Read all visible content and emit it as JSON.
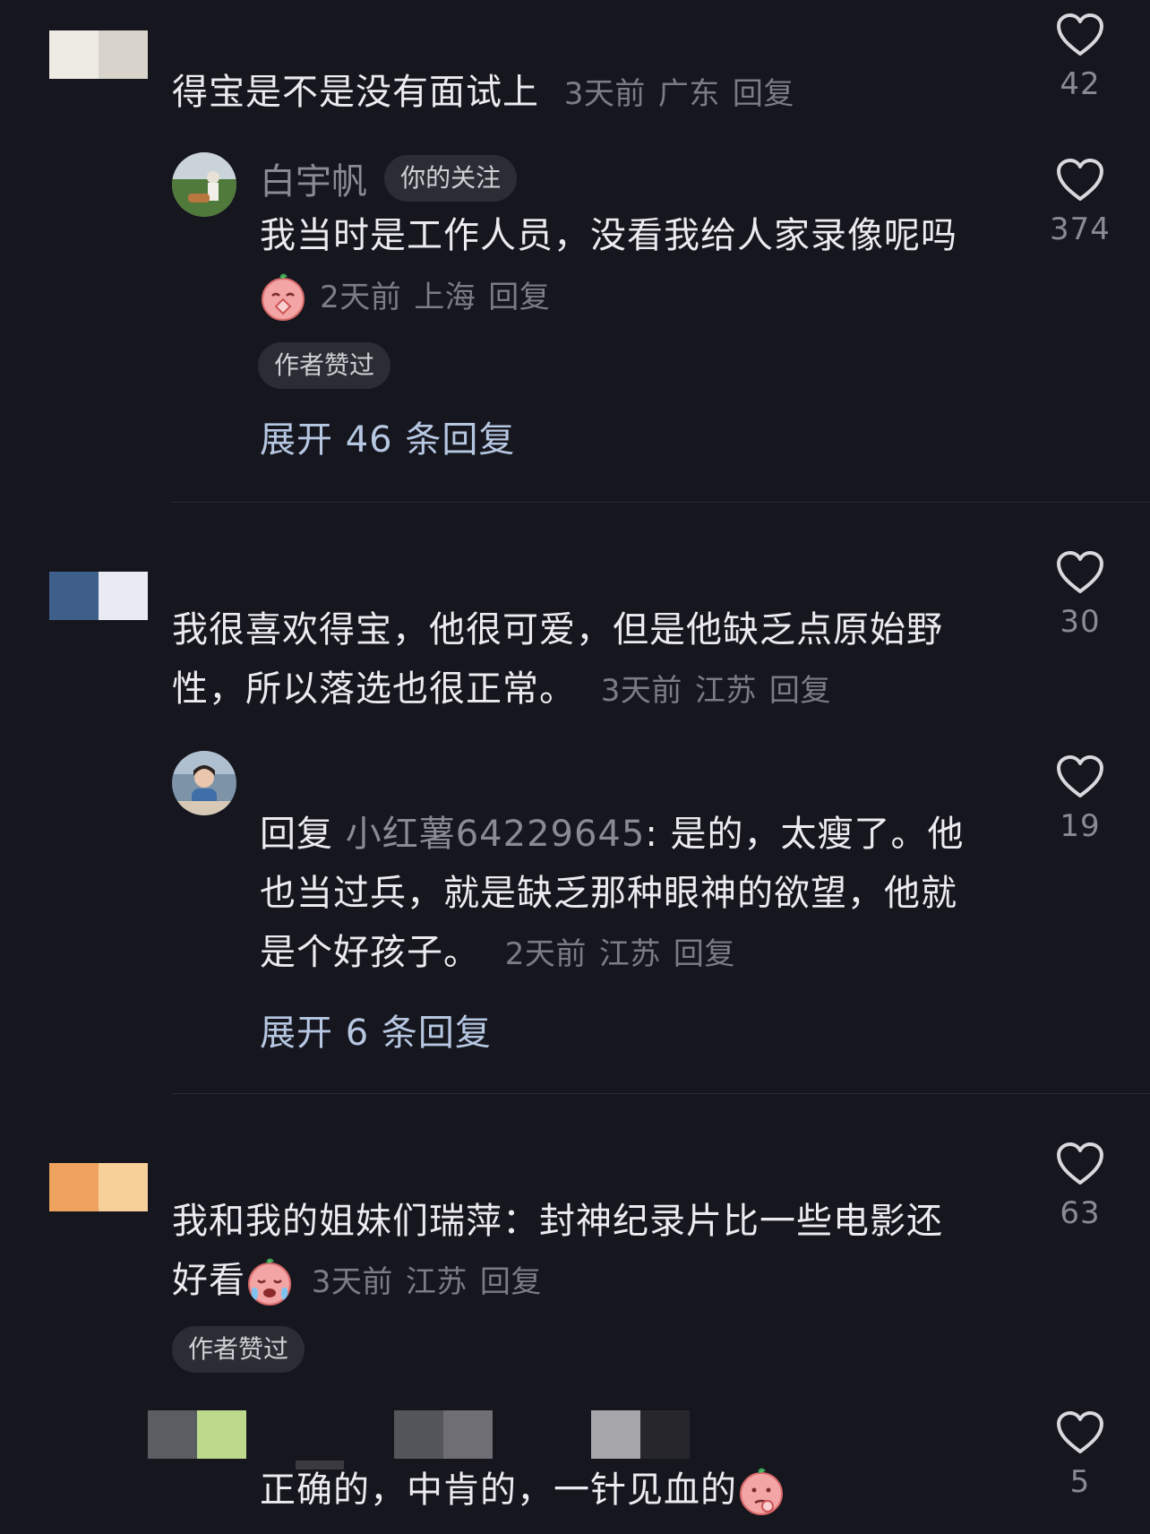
{
  "comments": [
    {
      "text": "得宝是不是没有面试上",
      "time": "3天前",
      "region": "广东",
      "reply_label": "回复",
      "likes": "42",
      "avatar_colors": [
        "#eeebe4",
        "#d9d4cb"
      ]
    },
    {
      "username": "白宇帆",
      "badge": "你的关注",
      "text": "我当时是工作人员，没看我给人家录像呢吗",
      "emoji": "clasped-hands-emoji",
      "time": "2天前",
      "region": "上海",
      "reply_label": "回复",
      "author_liked": "作者赞过",
      "expand_label": "展开 46 条回复",
      "likes": "374"
    },
    {
      "text_line1": "我很喜欢得宝，他很可爱，但是他缺乏点原始野",
      "text_line2": "性，所以落选也很正常。",
      "time": "3天前",
      "region": "江苏",
      "reply_label": "回复",
      "likes": "30",
      "avatar_colors": [
        "#3d5f8a",
        "#e8ecf2"
      ]
    },
    {
      "reply_prefix": "回复",
      "reply_to": "小红薯64229645",
      "text_line1": ": 是的，太瘦了。他",
      "text_line2": "也当过兵，就是缺乏那种眼神的欲望，他就",
      "text_line3": "是个好孩子。",
      "time": "2天前",
      "region": "江苏",
      "reply_label": "回复",
      "expand_label": "展开 6 条回复",
      "likes": "19"
    },
    {
      "text_line1": "我和我的姐妹们瑞萍：封神纪录片比一些电影还",
      "text_line2": "好看",
      "emoji": "crying-emoji",
      "time": "3天前",
      "region": "江苏",
      "reply_label": "回复",
      "author_liked": "作者赞过",
      "likes": "63",
      "avatar_colors": [
        "#eea25e",
        "#f7cf99"
      ]
    },
    {
      "text": "正确的，中肯的，一针见血的",
      "emoji": "thinking-emoji",
      "likes": "5"
    }
  ],
  "colors": {
    "background": "#16161e",
    "expand_link": "#b6c7e2",
    "meta": "#7c7c86"
  }
}
